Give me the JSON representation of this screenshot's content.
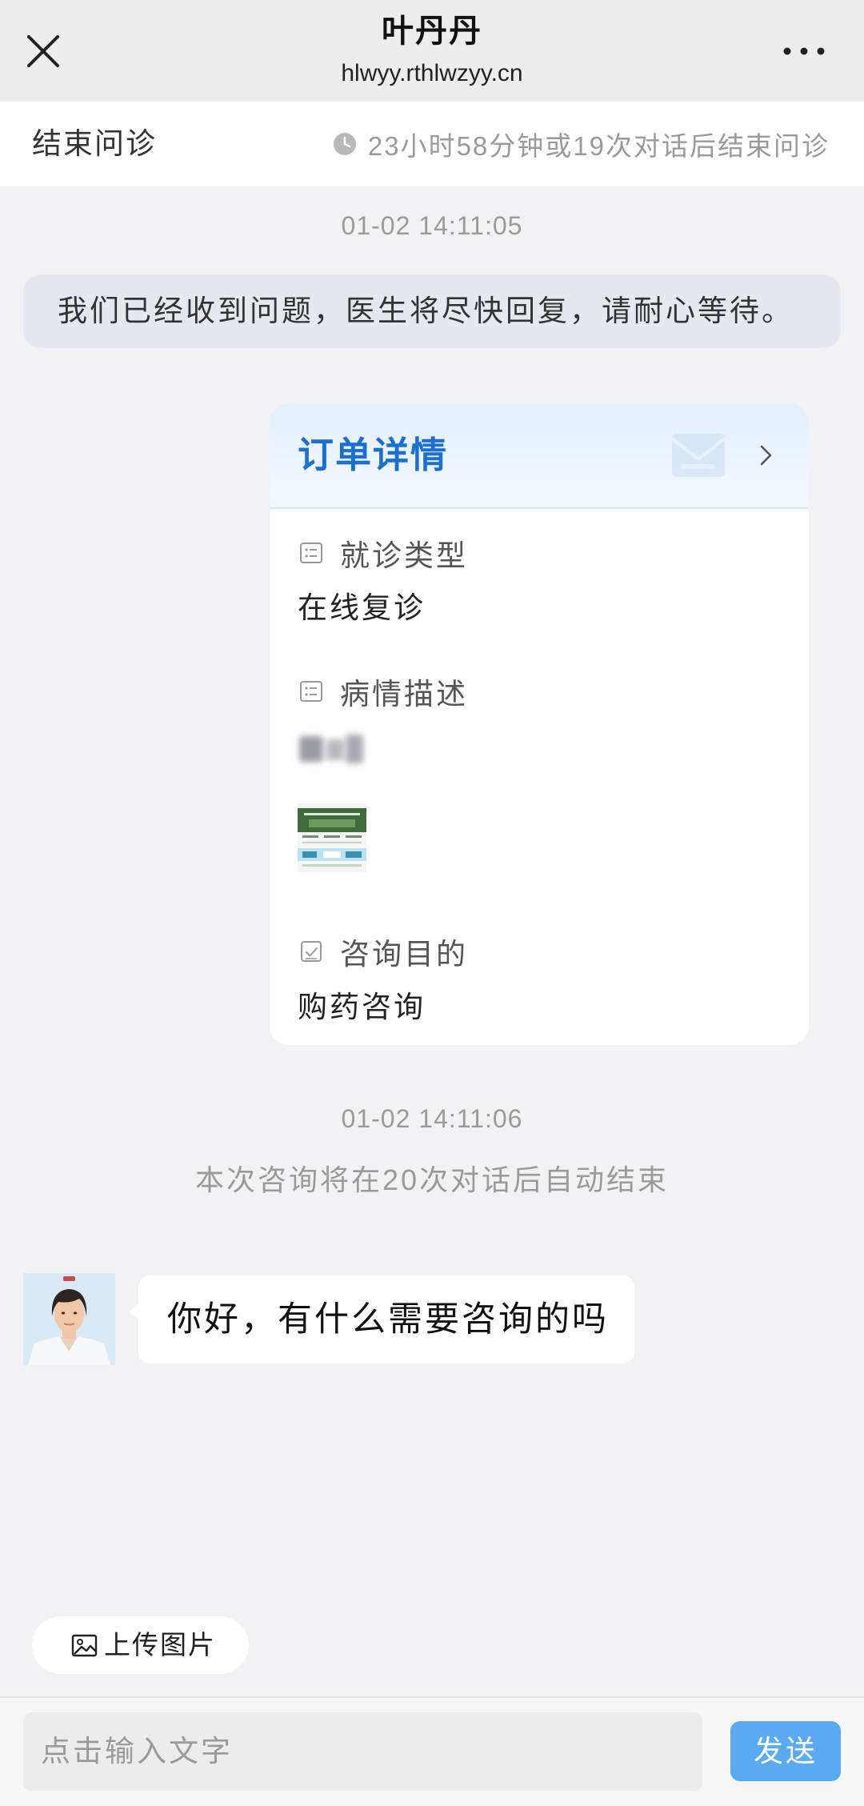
{
  "header": {
    "title": "叶丹丹",
    "subtitle": "hlwyy.rthlwzyy.cn",
    "close_icon": "close-icon",
    "more_icon": "more-icon"
  },
  "consult_bar": {
    "end_label": "结束问诊",
    "remaining_icon": "clock-icon",
    "remaining_text": "23小时58分钟或19次对话后结束问诊"
  },
  "chat": {
    "timestamps": [
      "01-02 14:11:05",
      "01-02 14:11:06"
    ],
    "system_message": "我们已经收到问题，医生将尽快回复，请耐心等待。",
    "order_card": {
      "title": "订单详情",
      "header_icons": [
        "envelope-icon",
        "chevron-right-icon"
      ],
      "fields": [
        {
          "icon": "list-icon",
          "label": "就诊类型",
          "value": "在线复诊"
        },
        {
          "icon": "list-icon",
          "label": "病情描述"
        },
        {
          "icon": "checkbox-icon",
          "label": "咨询目的",
          "value": "购药咨询"
        }
      ]
    },
    "auto_end_notice": "本次咨询将在20次对话后自动结束",
    "doctor_message": "你好，有什么需要咨询的吗"
  },
  "composer": {
    "upload_icon": "image-icon",
    "upload_label": "上传图片",
    "input_placeholder": "点击输入文字",
    "send_label": "发送"
  },
  "colors": {
    "header_bg": "#ededed",
    "page_bg": "#f2f2f4",
    "system_message_bg": "#e5e8ee",
    "accent": "#1a6fd1",
    "send_button": "#5aaaf2"
  }
}
